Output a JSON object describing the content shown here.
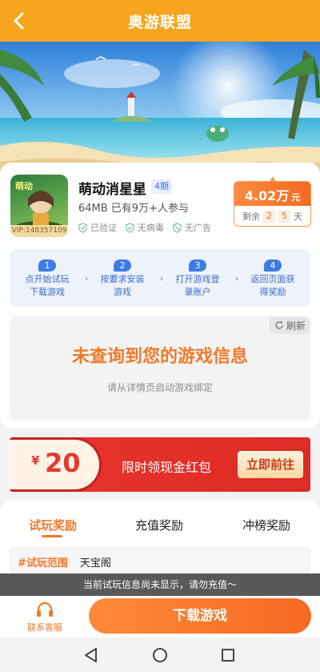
{
  "header": {
    "title": "奥游联盟",
    "back_icon": "back-arrow-icon"
  },
  "game": {
    "name": "萌动消星星",
    "period": "4期",
    "meta": "64MB 已有9万+人参与",
    "vip_id": "VIP:148357109",
    "badges": [
      "已验证",
      "无病毒",
      "无广告"
    ]
  },
  "reward": {
    "amount": "4.02万",
    "unit": "元",
    "remaining_label": "剩余",
    "days_tens": "2",
    "days_ones": "5",
    "days_unit": "天"
  },
  "steps": [
    {
      "num": "1",
      "line1": "点开始试玩",
      "line2": "下载游戏"
    },
    {
      "num": "2",
      "line1": "按要求安装",
      "line2": "游戏"
    },
    {
      "num": "3",
      "line1": "打开游戏登",
      "line2": "录账户"
    },
    {
      "num": "4",
      "line1": "返回页面获",
      "line2": "得奖励"
    }
  ],
  "info": {
    "refresh": "刷新",
    "title": "未查询到您的游戏信息",
    "subtitle": "请从详情页启动游戏绑定"
  },
  "red_packet": {
    "currency": "¥",
    "amount": "20",
    "text": "限时领现金红包",
    "button": "立即前往"
  },
  "tabs": [
    "试玩奖励",
    "充值奖励",
    "冲榜奖励"
  ],
  "range": {
    "label": "#试玩范围",
    "value": "天宝阁"
  },
  "toast": "当前试玩信息尚未显示，请勿充值～",
  "bottom": {
    "service": "联系客服",
    "download": "下载游戏"
  },
  "colors": {
    "brand_orange": "#f6a51c",
    "accent_orange": "#f07a2a",
    "step_blue": "#3d7ce5",
    "red": "#e5392d"
  }
}
